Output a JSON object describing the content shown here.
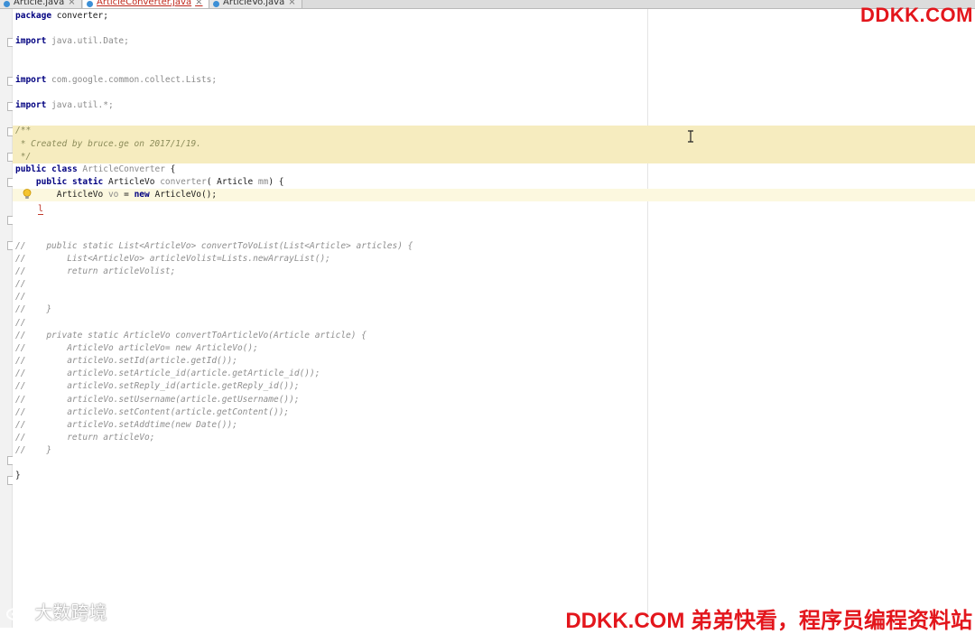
{
  "tabs": [
    {
      "label": "Article.java",
      "close": "×",
      "active": false
    },
    {
      "label": "ArticleConverter.java",
      "close": "×",
      "active": true
    },
    {
      "label": "ArticleVo.java",
      "close": "×",
      "active": false
    }
  ],
  "code_lines": {
    "l1": "package converter;",
    "l3": "import java.util.Date;",
    "l6": "import com.google.common.collect.Lists;",
    "l8": "import java.util.*;",
    "doc1": "/**",
    "doc2": " * Created by bruce.ge on 2017/1/19.",
    "doc3": " */",
    "cls": "public class ArticleConverter {",
    "m1": "    public static ArticleVo converter( Article mm) {",
    "m2": "        ArticleVo vo = new ArticleVo();",
    "m3": "    }",
    "c1": "//    public static List<ArticleVo> convertToVoList(List<Article> articles) {",
    "c2": "//        List<ArticleVo> articleVolist=Lists.newArrayList();",
    "c3": "//        return articleVolist;",
    "c4": "//",
    "c5": "//",
    "c6": "//    }",
    "c7": "//",
    "c8": "//    private static ArticleVo convertToArticleVo(Article article) {",
    "c9": "//        ArticleVo articleVo= new ArticleVo();",
    "c10": "//        articleVo.setId(article.getId());",
    "c11": "//        articleVo.setArticle_id(article.getArticle_id());",
    "c12": "//        articleVo.setReply_id(article.getReply_id());",
    "c13": "//        articleVo.setUsername(article.getUsername());",
    "c14": "//        articleVo.setContent(article.getContent());",
    "c15": "//        articleVo.setAddtime(new Date());",
    "c16": "//        return articleVo;",
    "c17": "//    }",
    "end": "}"
  },
  "watermarks": {
    "top_right": "DDKK.COM",
    "bottom_right": "DDKK.COM 弟弟快看，程序员编程资料站",
    "bottom_left": "大数跨境"
  },
  "colors": {
    "keyword": "#000080",
    "doc_band": "#f6ecbf",
    "current_line": "#fcf8df",
    "watermark": "#e3161c"
  },
  "icons": [
    "intention-bulb-icon",
    "text-cursor-icon",
    "weibo-logo-icon"
  ]
}
